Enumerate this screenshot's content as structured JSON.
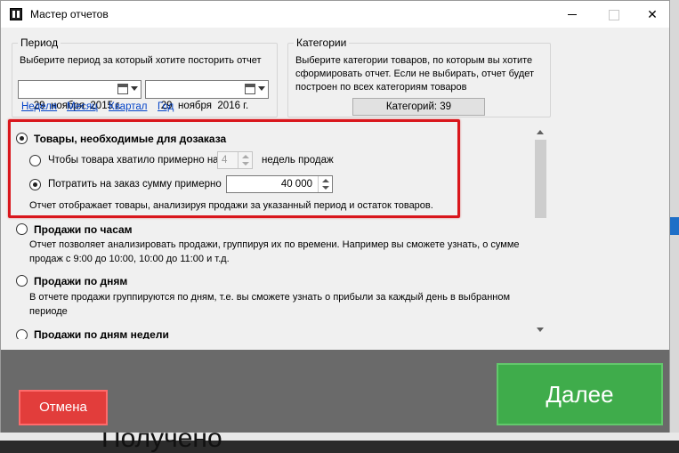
{
  "window": {
    "title": "Мастер отчетов"
  },
  "period": {
    "legend": "Период",
    "description": "Выберите период за который хотите посторить отчет",
    "date_from": "29  ноября  2015 г.",
    "date_to": "29  ноября  2016 г.",
    "links": [
      "Неделя",
      "Месяц",
      "Квартал",
      "Год"
    ]
  },
  "categories": {
    "legend": "Категории",
    "description": "Выберите категории товаров, по которым вы хотите сформировать отчет. Если не выбирать, отчет будет построен по всех категориям товаров",
    "button_label": "Категорий: 39"
  },
  "options": [
    {
      "title": "Товары, необходимые для дозаказа",
      "checked": true,
      "sub_option_1_label": "Чтобы товара хватило примерно на",
      "weeks_value": "4",
      "weeks_suffix": "недель продаж",
      "sub_option_2_label": "Потратить на заказ сумму примерно",
      "amount_value": "40 000",
      "description": "Отчет отображает товары, анализируя продажи за указанный период и остаток товаров."
    },
    {
      "title": "Продажи по часам",
      "checked": false,
      "description": "Отчет позволяет анализировать продажи, группируя их по времени. Например вы сможете узнать, о сумме продаж с 9:00 до 10:00, 10:00 до 11:00 и т.д."
    },
    {
      "title": "Продажи по дням",
      "checked": false,
      "description": "В отчете продажи группируются по дням, т.е. вы сможете узнать о прибыли за каждый день в выбранном периоде"
    },
    {
      "title": "Продажи по дням недели",
      "checked": false
    }
  ],
  "buttons": {
    "cancel": "Отмена",
    "next": "Далее"
  },
  "background": {
    "text": "Получено"
  },
  "colors": {
    "cancel": "#e23d3b",
    "next": "#3fac4b",
    "highlight": "#d9161c",
    "link": "#0645c9"
  }
}
